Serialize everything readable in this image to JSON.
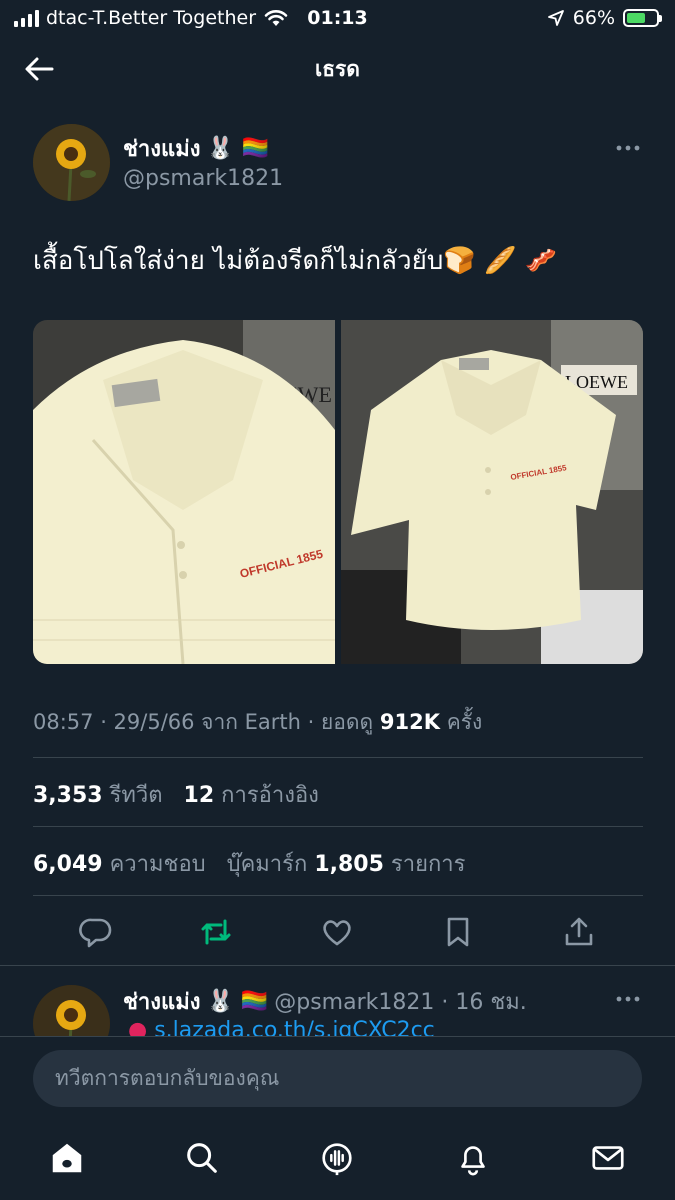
{
  "status_bar": {
    "carrier": "dtac-T.Better Together",
    "time": "01:13",
    "battery": "66%",
    "battery_level": 0.66
  },
  "header": {
    "title": "เธรด"
  },
  "tweet": {
    "display_name": "ช่างแม่ง",
    "name_emojis": "🐰 🏳️‍🌈",
    "handle": "@psmark1821",
    "text": "เสื้อโปโลใส่ง่าย ไม่ต้องรีดก็ไม่กลัวยับ🍞 🥖 🥓",
    "media": [
      {
        "alt": "cream waffle-knit polo close-up",
        "badge_text": "OFFICIAL 1855"
      },
      {
        "alt": "cream waffle-knit polo full view",
        "badge_text": "OFFICIAL 1855",
        "sign_text": "LOEWE"
      }
    ],
    "timestamp": "08:57 · 29/5/66 จาก Earth · ยอดดู",
    "views": "912K",
    "views_suffix": "ครั้ง",
    "retweets": "3,353",
    "retweets_label": "รีทวีต",
    "quotes": "12",
    "quotes_label": "การอ้างอิง",
    "likes": "6,049",
    "likes_label": "ความชอบ",
    "bookmarks_label": "บุ๊คมาร์ก",
    "bookmarks": "1,805",
    "bookmarks_suffix": "รายการ"
  },
  "actions": {
    "icons": [
      "reply-icon",
      "retweet-icon",
      "like-icon",
      "bookmark-icon",
      "share-icon"
    ],
    "retweet_color": "#00ba7c"
  },
  "reply": {
    "display_name": "ช่างแม่ง",
    "name_emojis": "🐰 🏳️‍🌈",
    "handle_time": "@psmark1821 · 16 ชม.",
    "link": "s.lazada.co.th/s.jgCXC2cc"
  },
  "compose": {
    "placeholder": "ทวีตการตอบกลับของคุณ"
  },
  "tab_bar": {
    "icons": [
      "home-icon",
      "search-icon",
      "spaces-icon",
      "notifications-icon",
      "messages-icon"
    ]
  },
  "colors": {
    "background": "#15202b",
    "secondary_text": "#8b98a5",
    "link": "#1d9bf0",
    "divider": "#38444d"
  }
}
